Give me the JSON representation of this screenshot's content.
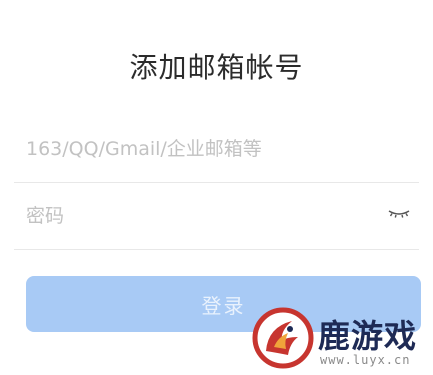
{
  "page": {
    "title": "添加邮箱帐号"
  },
  "form": {
    "email": {
      "placeholder": "163/QQ/Gmail/企业邮箱等",
      "value": ""
    },
    "password": {
      "placeholder": "密码",
      "value": ""
    },
    "password_toggle_icon": "eye-closed-icon",
    "login_label": "登录"
  },
  "watermark": {
    "name": "鹿游戏",
    "url": "www.luyx.cn"
  },
  "colors": {
    "button_bg": "#a8caf5",
    "button_text": "#e9f2fd",
    "placeholder": "#c2c2c2",
    "title": "#2b2b2b",
    "divider": "#e8e8e8"
  }
}
